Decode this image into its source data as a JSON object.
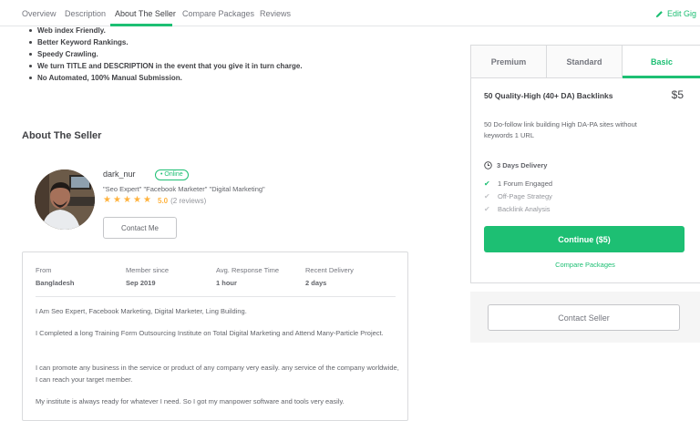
{
  "nav": {
    "tabs": [
      {
        "label": "Overview"
      },
      {
        "label": "Description"
      },
      {
        "label": "About The Seller"
      },
      {
        "label": "Compare Packages"
      },
      {
        "label": "Reviews"
      }
    ],
    "active_tab": "About The Seller",
    "edit_label": "Edit Gig"
  },
  "features": [
    "Web index Friendly.",
    "Better Keyword Rankings.",
    "Speedy Crawling.",
    "We turn TITLE and DESCRIPTION in the event that you give it in turn charge.",
    "No Automated, 100% Manual Submission."
  ],
  "seller": {
    "section_title": "About The Seller",
    "name": "dark_nur",
    "status": "Online",
    "tagline": "\"Seo Expert\" \"Facebook Marketer\" \"Digital Marketing\"",
    "rating": "5.0",
    "reviews": "(2 reviews)",
    "stars": 5,
    "contact_button": "Contact Me"
  },
  "stats": [
    {
      "label": "From",
      "value": "Bangladesh"
    },
    {
      "label": "Member since",
      "value": "Sep 2019"
    },
    {
      "label": "Avg. Response Time",
      "value": "1 hour"
    },
    {
      "label": "Recent Delivery",
      "value": "2 days"
    }
  ],
  "description": [
    "I Am Seo Expert, Facebook Marketing, Digital Marketer, Ling Building.",
    "I Completed a long Training Form Outsourcing Institute on Total Digital Marketing and Attend Many-Particle Project.",
    "I can promote any business in the service or product of any company very easily. any service of the company worldwide, I can reach your target member.",
    "My institute is always ready for whatever I need. So I got my manpower software and tools very easily."
  ],
  "package": {
    "tabs": [
      {
        "label": "Premium"
      },
      {
        "label": "Standard"
      },
      {
        "label": "Basic"
      }
    ],
    "active_tab": "Basic",
    "title": "50 Quality-High (40+ DA) Backlinks",
    "price": "$5",
    "description": "50 Do-follow link building High DA-PA sites without keywords 1 URL",
    "delivery": "3 Days Delivery",
    "features": [
      {
        "label": "1 Forum Engaged",
        "included": true
      },
      {
        "label": "Off-Page Strategy",
        "included": false
      },
      {
        "label": "Backlink Analysis",
        "included": false
      }
    ],
    "continue_label": "Continue ($5)",
    "compare_label": "Compare Packages"
  },
  "contact_seller_label": "Contact Seller",
  "colors": {
    "accent": "#1dbf73",
    "star": "#ffb33e",
    "text": "#404145",
    "muted": "#74767e"
  }
}
